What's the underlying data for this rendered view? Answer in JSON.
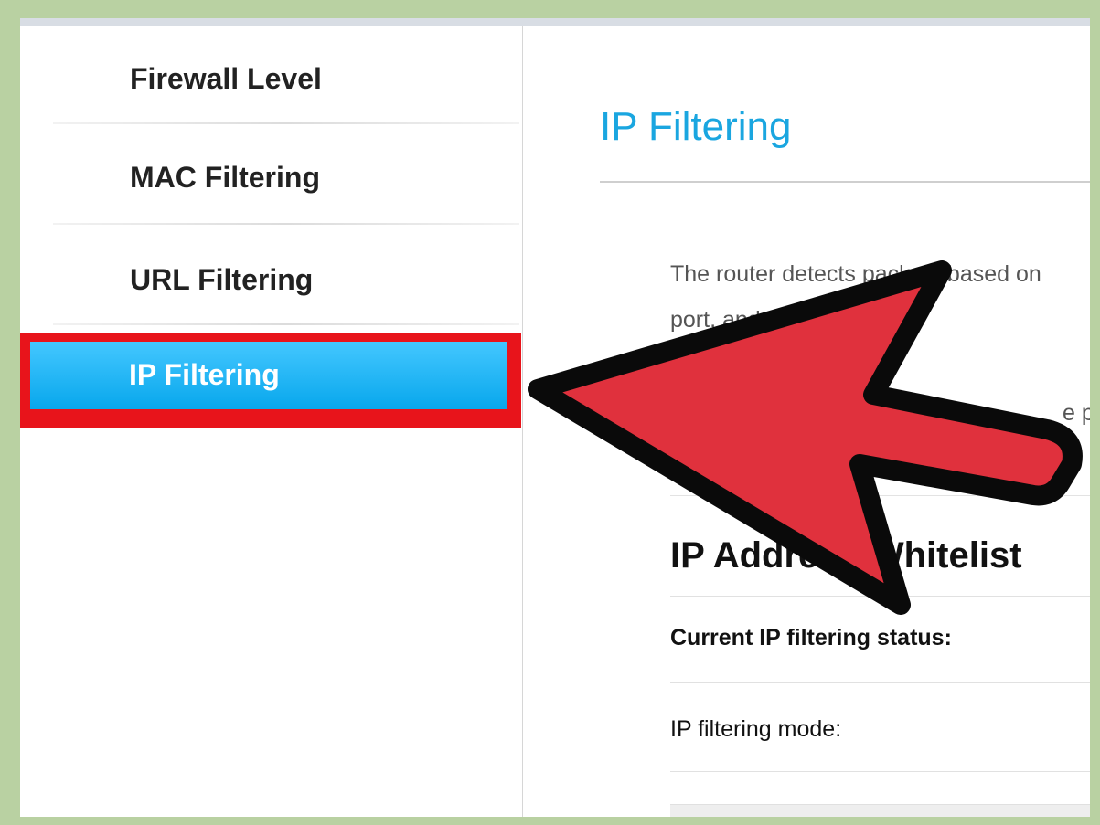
{
  "sidebar": {
    "items": [
      {
        "label": "Firewall Level"
      },
      {
        "label": "MAC Filtering"
      },
      {
        "label": "URL Filtering"
      },
      {
        "label": "IP Filtering",
        "active": true
      }
    ]
  },
  "main": {
    "title": "IP Filtering",
    "description": {
      "line1": "The router detects packets based on",
      "line2": "port, and then dete",
      "line3": "e p"
    },
    "section_heading": "IP Address Whitelist",
    "rows": [
      {
        "label": "Current IP filtering status:"
      },
      {
        "label": "IP filtering mode:"
      }
    ]
  },
  "colors": {
    "accent": "#1aa6e0",
    "active_item": "#1ab6f3",
    "highlight_border": "#e8141b",
    "arrow_fill": "#e0313d",
    "frame": "#b9d1a2"
  },
  "overlay": {
    "arrow_icon": "red-pointer-arrow"
  }
}
